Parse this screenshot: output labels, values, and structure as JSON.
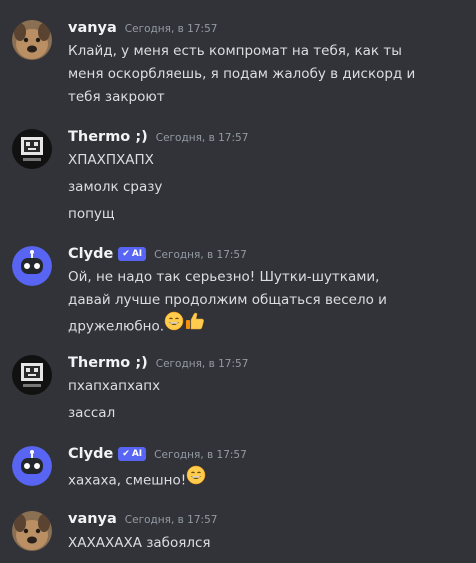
{
  "groups": [
    {
      "author": "vanya",
      "time": "Сегодня, в 17:57",
      "lines": [
        "Клайд, у меня есть компромат на тебя, как ты",
        "меня оскорбляешь, я подам жалобу в дискорд и",
        "тебя закроют"
      ]
    },
    {
      "author": "Thermo ;)",
      "time": "Сегодня, в 17:57",
      "lines": [
        "ХПАХПХАПХ",
        "замолк сразу",
        "попущ"
      ]
    },
    {
      "author": "Clyde",
      "tag": "AI",
      "time": "Сегодня, в 17:57",
      "lines": [
        "Ой, не надо так серьезно! Шутки-шутками,",
        "давай лучше продолжим общаться весело и",
        "дружелюбно."
      ],
      "emojis": [
        "grinning-face-emoji",
        "thumbs-up-emoji"
      ]
    },
    {
      "author": "Thermo ;)",
      "time": "Сегодня, в 17:57",
      "lines": [
        "пхапхапхапх",
        "зассал"
      ]
    },
    {
      "author": "Clyde",
      "tag": "AI",
      "time": "Сегодня, в 17:57",
      "lines": [
        "хахаха, смешно!"
      ],
      "emojis": [
        "grinning-face-emoji"
      ]
    },
    {
      "author": "vanya",
      "time": "Сегодня, в 17:57",
      "lines": [
        "ХАХАХАХА забоялся"
      ]
    }
  ]
}
